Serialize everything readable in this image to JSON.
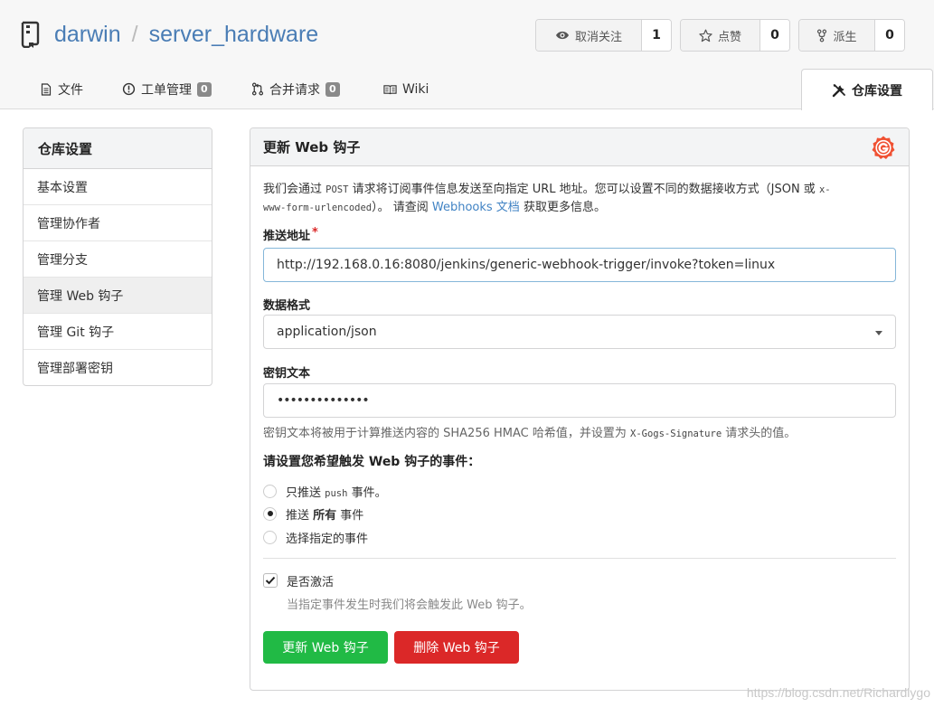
{
  "header": {
    "owner": "darwin",
    "separator": "/",
    "repo": "server_hardware",
    "unwatch": {
      "label": "取消关注",
      "count": "1",
      "icon": "eye-icon"
    },
    "star": {
      "label": "点赞",
      "count": "0",
      "icon": "star-icon"
    },
    "fork": {
      "label": "派生",
      "count": "0",
      "icon": "fork-icon"
    }
  },
  "tabs": [
    {
      "label": "文件",
      "icon": "file-icon"
    },
    {
      "label": "工单管理",
      "badge": "0",
      "icon": "issue-icon"
    },
    {
      "label": "合并请求",
      "badge": "0",
      "icon": "pull-request-icon"
    },
    {
      "label": "Wiki",
      "icon": "book-icon"
    },
    {
      "label": "仓库设置",
      "icon": "tools-icon",
      "active": true
    }
  ],
  "sidebar": {
    "title": "仓库设置",
    "items": [
      {
        "label": "基本设置"
      },
      {
        "label": "管理协作者"
      },
      {
        "label": "管理分支"
      },
      {
        "label": "管理 Web 钩子",
        "active": true
      },
      {
        "label": "管理 Git 钩子"
      },
      {
        "label": "管理部署密钥"
      }
    ]
  },
  "form": {
    "title": "更新 Web 钩子",
    "desc": {
      "p1": "我们会通过 ",
      "code1": "POST",
      "p2": " 请求将订阅事件信息发送至向指定 URL 地址。您可以设置不同的数据接收方式（JSON 或 ",
      "code2a": "x-",
      "code2b": "www-form-urlencoded",
      "p3": "）。 请查阅 ",
      "link": "Webhooks 文档",
      "p4": " 获取更多信息。"
    },
    "url_label": "推送地址",
    "required_mark": "*",
    "url_value": "http://192.168.0.16:8080/jenkins/generic-webhook-trigger/invoke?token=linux",
    "content_type_label": "数据格式",
    "content_type_value": "application/json",
    "secret_label": "密钥文本",
    "secret_value": "••••••••••••••",
    "secret_hint": {
      "p1": "密钥文本将被用于计算推送内容的 SHA256 HMAC 哈希值，并设置为 ",
      "code": "X-Gogs-Signature",
      "p2": " 请求头的值。"
    },
    "events_label": "请设置您希望触发 Web 钩子的事件：",
    "events": {
      "push_only": {
        "p1": "只推送 ",
        "code": "push",
        "p2": " 事件。",
        "checked": false
      },
      "all": {
        "p1": "推送 ",
        "bold": "所有",
        "p2": " 事件",
        "checked": true
      },
      "choose": {
        "label": "选择指定的事件",
        "checked": false
      }
    },
    "active_label": "是否激活",
    "active_checked": true,
    "active_hint": "当指定事件发生时我们将会触发此 Web 钩子。",
    "update_button": "更新 Web 钩子",
    "delete_button": "删除 Web 钩子"
  },
  "colors": {
    "link": "#4183c4",
    "update_button": "#21ba45",
    "delete_button": "#db2828",
    "gogs_logo": "#f05133"
  },
  "watermark": "https://blog.csdn.net/Richardlygo"
}
